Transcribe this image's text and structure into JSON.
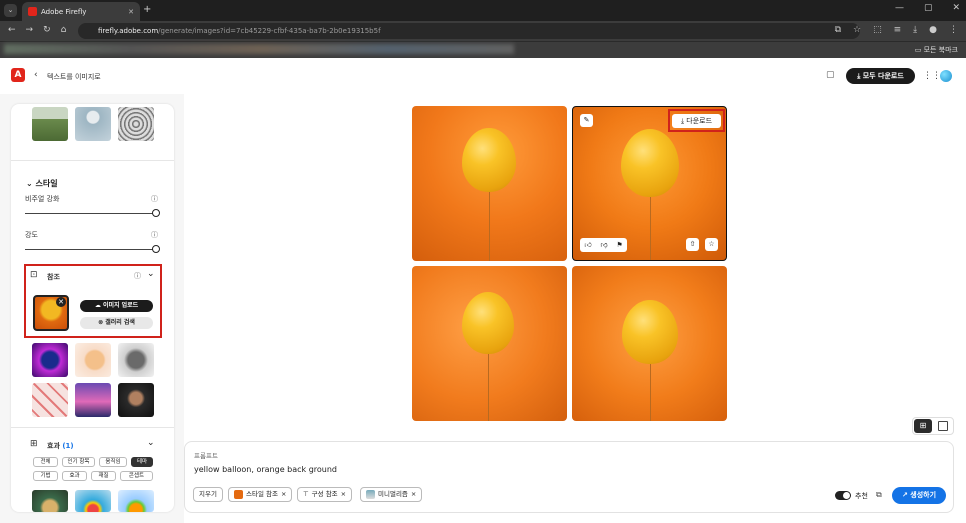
{
  "browser": {
    "tab_title": "Adobe Firefly",
    "tab_close": "✕",
    "new_tab": "+",
    "window_controls": [
      "—",
      "▢",
      "✕"
    ],
    "url_host": "firefly.adobe.com",
    "url_path": "/generate/images?id=7cb45229-cfbf-435a-ba7b-2b0e19315b5f",
    "all_bookmarks": "모든 북마크"
  },
  "app": {
    "logo": "A",
    "breadcrumb": "텍스트를 이미지로",
    "download_all": "모두 다운로드"
  },
  "panel": {
    "style_section": "스타일",
    "visual_intensity": "비주얼 강화",
    "strength": "강도",
    "reference_section": "참조",
    "upload_image": "이미지 업로드",
    "gallery_search": "갤러리 검색",
    "effects_section": "효과",
    "effects_count": "(1)",
    "effect_chips": [
      "전체",
      "인기 항목",
      "움직임",
      "테마",
      "기법",
      "효과",
      "재질",
      "콘셉트"
    ],
    "selected_chip": "테마"
  },
  "gallery": {
    "download_label": "다운로드"
  },
  "prompt": {
    "label": "프롬프트",
    "text": "yellow balloon, orange back ground",
    "clear": "지우기",
    "chips": [
      "스타일 참조",
      "구성 참조",
      "미니멀리즘"
    ],
    "recommend": "추천",
    "generate": "생성하기"
  },
  "colors": {
    "accent_red": "#d0221b",
    "generate_blue": "#1473e6",
    "brand_red": "#e1251b"
  }
}
